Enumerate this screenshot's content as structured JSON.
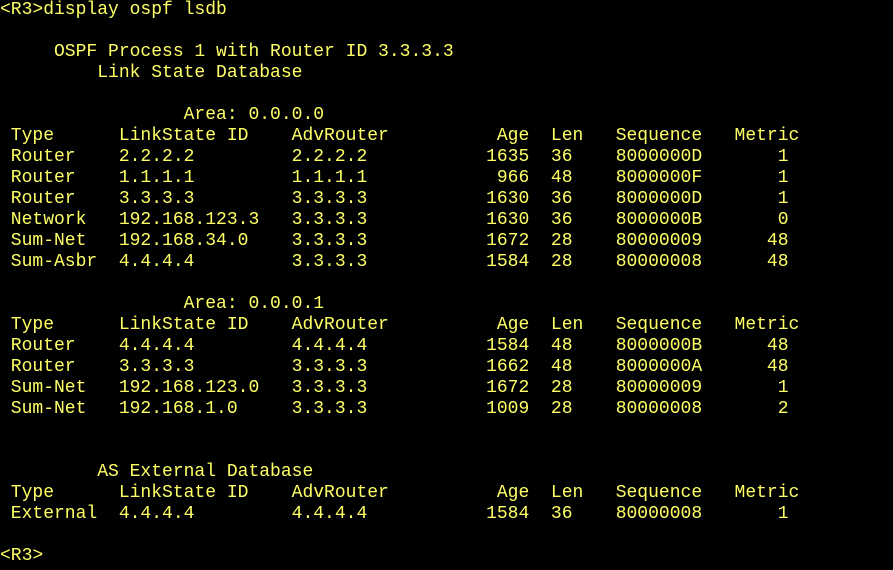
{
  "terminal": {
    "text_color": "#ffff66",
    "background": "#000000",
    "lines": [
      "<R3>display ospf lsdb",
      "",
      "     OSPF Process 1 with Router ID 3.3.3.3",
      "         Link State Database",
      "",
      "                 Area: 0.0.0.0",
      " Type      LinkState ID    AdvRouter          Age  Len   Sequence   Metric",
      " Router    2.2.2.2         2.2.2.2           1635  36    8000000D       1",
      " Router    1.1.1.1         1.1.1.1            966  48    8000000F       1",
      " Router    3.3.3.3         3.3.3.3           1630  36    8000000D       1",
      " Network   192.168.123.3   3.3.3.3           1630  36    8000000B       0",
      " Sum-Net   192.168.34.0    3.3.3.3           1672  28    80000009      48",
      " Sum-Asbr  4.4.4.4         3.3.3.3           1584  28    80000008      48",
      "",
      "                 Area: 0.0.0.1",
      " Type      LinkState ID    AdvRouter          Age  Len   Sequence   Metric",
      " Router    4.4.4.4         4.4.4.4           1584  48    8000000B      48",
      " Router    3.3.3.3         3.3.3.3           1662  48    8000000A      48",
      " Sum-Net   192.168.123.0   3.3.3.3           1672  28    80000009       1",
      " Sum-Net   192.168.1.0     3.3.3.3           1009  28    80000008       2",
      "",
      "",
      "         AS External Database",
      " Type      LinkState ID    AdvRouter          Age  Len   Sequence   Metric",
      " External  4.4.4.4         4.4.4.4           1584  36    80000008       1",
      "",
      "<R3>"
    ]
  }
}
